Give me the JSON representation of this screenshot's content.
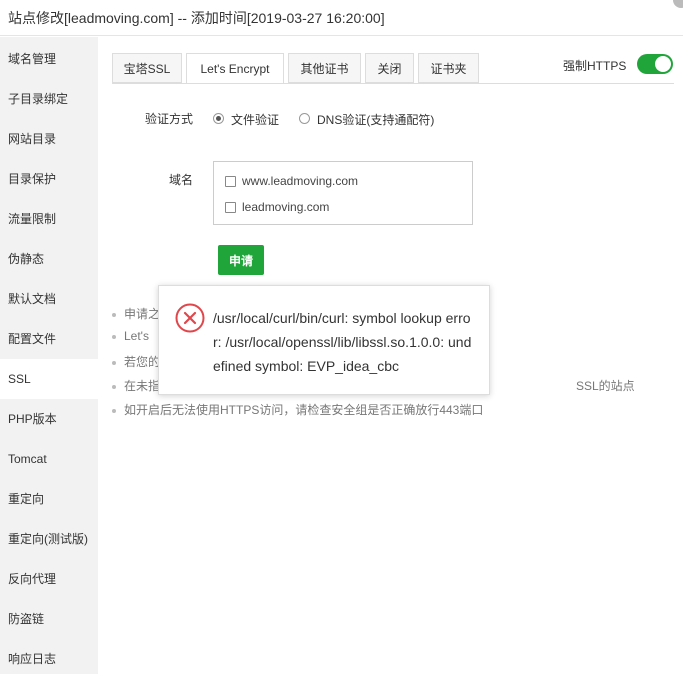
{
  "window": {
    "title": "站点修改[leadmoving.com] -- 添加时间[2019-03-27 16:20:00]"
  },
  "sidebar": {
    "items": [
      {
        "label": "域名管理"
      },
      {
        "label": "子目录绑定"
      },
      {
        "label": "网站目录"
      },
      {
        "label": "目录保护"
      },
      {
        "label": "流量限制"
      },
      {
        "label": "伪静态"
      },
      {
        "label": "默认文档"
      },
      {
        "label": "配置文件"
      },
      {
        "label": "SSL"
      },
      {
        "label": "PHP版本"
      },
      {
        "label": "Tomcat"
      },
      {
        "label": "重定向"
      },
      {
        "label": "重定向(测试版)"
      },
      {
        "label": "反向代理"
      },
      {
        "label": "防盗链"
      },
      {
        "label": "响应日志"
      }
    ],
    "active": "SSL"
  },
  "tabs": [
    {
      "label": "宝塔SSL"
    },
    {
      "label": "Let's Encrypt"
    },
    {
      "label": "其他证书"
    },
    {
      "label": "关闭"
    },
    {
      "label": "证书夹"
    }
  ],
  "active_tab": "Let's Encrypt",
  "force_https": {
    "label": "强制HTTPS",
    "enabled": true
  },
  "verify": {
    "label": "验证方式",
    "options": [
      {
        "label": "文件验证",
        "checked": true
      },
      {
        "label": "DNS验证(支持通配符)",
        "checked": false
      }
    ]
  },
  "domains": {
    "label": "域名",
    "items": [
      {
        "label": "www.leadmoving.com",
        "checked": false
      },
      {
        "label": "leadmoving.com",
        "checked": false
      }
    ]
  },
  "apply_button": "申请",
  "tips": {
    "partial": [
      "申请之",
      "Let's",
      "若您的",
      "在未指"
    ],
    "tail": "SSL的站点",
    "last": "如开启后无法使用HTTPS访问，请检查安全组是否正确放行443端口"
  },
  "error_dialog": {
    "message": "/usr/local/curl/bin/curl: symbol lookup error: /usr/local/openssl/lib/libssl.so.1.0.0: undefined symbol: EVP_idea_cbc",
    "icon": "error-x-circle-icon",
    "icon_color": "#e0474c"
  },
  "colors": {
    "accent": "#20a53a",
    "sidebar_bg": "#f2f2f2"
  }
}
